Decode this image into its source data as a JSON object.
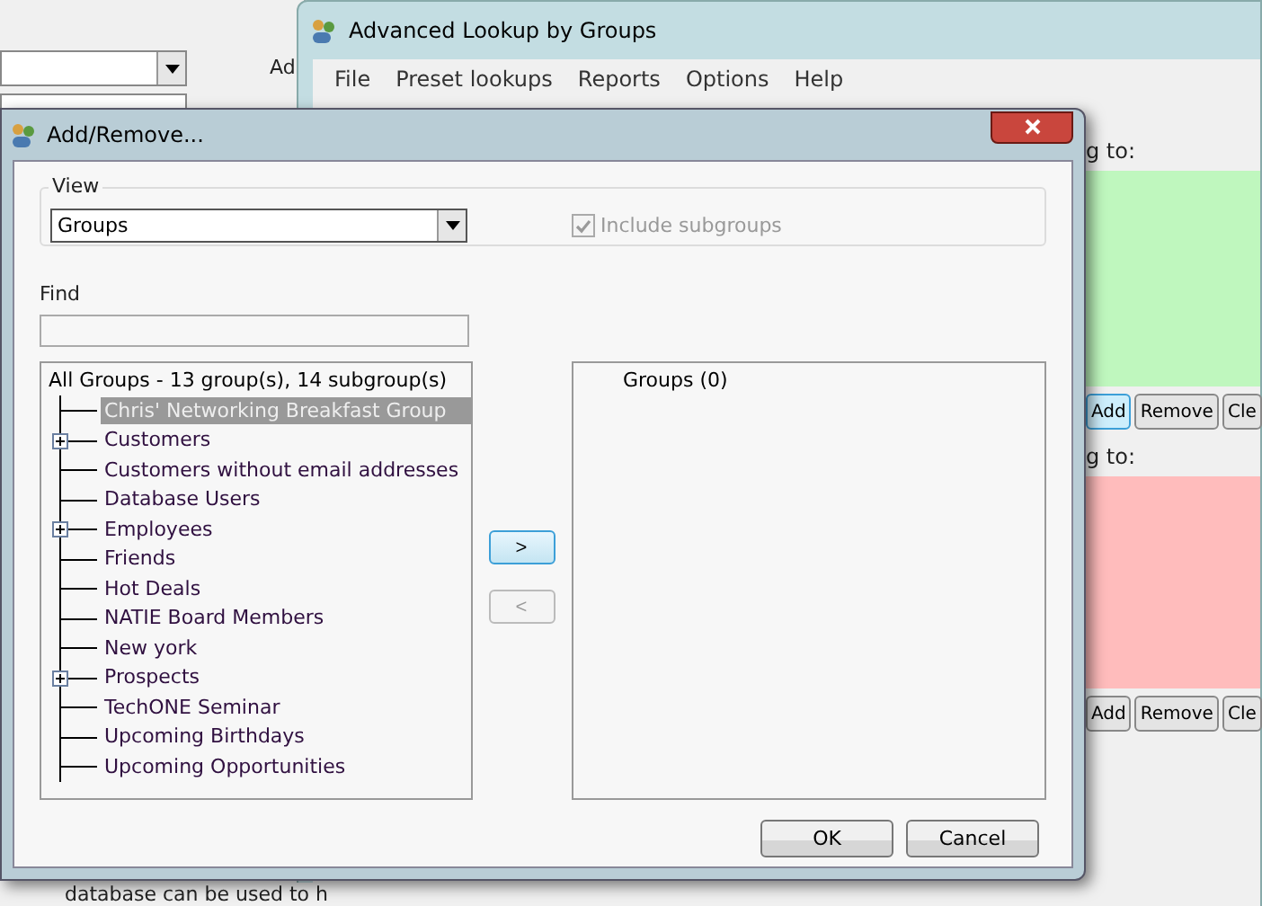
{
  "background_window": {
    "label": "Ad",
    "bottom_text": "database can be used to h"
  },
  "main_window": {
    "title": "Advanced Lookup by Groups",
    "menu": [
      "File",
      "Preset lookups",
      "Reports",
      "Options",
      "Help"
    ],
    "sections": [
      {
        "label": "g to:",
        "color": "#bff7be",
        "buttons": [
          {
            "label": "Add",
            "hovered": true
          },
          {
            "label": "Remove",
            "hovered": false
          },
          {
            "label": "Cle",
            "hovered": false
          }
        ]
      },
      {
        "label": "g to:",
        "color": "#ffbcbc",
        "buttons": [
          {
            "label": "Add",
            "hovered": false
          },
          {
            "label": "Remove",
            "hovered": false
          },
          {
            "label": "Cle",
            "hovered": false
          }
        ]
      }
    ]
  },
  "dialog": {
    "title": "Add/Remove...",
    "view": {
      "label": "View",
      "value": "Groups"
    },
    "include_subgroups": {
      "label": "Include subgroups",
      "checked": true,
      "disabled": true
    },
    "find": {
      "label": "Find"
    },
    "tree": {
      "header": "All Groups - 13 group(s), 14 subgroup(s)",
      "items": [
        {
          "label": "Chris' Networking Breakfast Group",
          "selected": true,
          "expandable": false
        },
        {
          "label": "Customers",
          "selected": false,
          "expandable": true
        },
        {
          "label": "Customers without email addresses",
          "selected": false,
          "expandable": false
        },
        {
          "label": "Database Users",
          "selected": false,
          "expandable": false
        },
        {
          "label": "Employees",
          "selected": false,
          "expandable": true
        },
        {
          "label": "Friends",
          "selected": false,
          "expandable": false
        },
        {
          "label": "Hot Deals",
          "selected": false,
          "expandable": false
        },
        {
          "label": "NATIE Board Members",
          "selected": false,
          "expandable": false
        },
        {
          "label": "New york",
          "selected": false,
          "expandable": false
        },
        {
          "label": "Prospects",
          "selected": false,
          "expandable": true
        },
        {
          "label": "TechONE Seminar",
          "selected": false,
          "expandable": false
        },
        {
          "label": "Upcoming Birthdays",
          "selected": false,
          "expandable": false
        },
        {
          "label": "Upcoming Opportunities",
          "selected": false,
          "expandable": false
        }
      ]
    },
    "move_buttons": [
      {
        "label": ">",
        "disabled": false
      },
      {
        "label": "<",
        "disabled": true
      }
    ],
    "selected_list": {
      "header": "Groups (0)"
    },
    "buttons": [
      "OK",
      "Cancel"
    ]
  }
}
